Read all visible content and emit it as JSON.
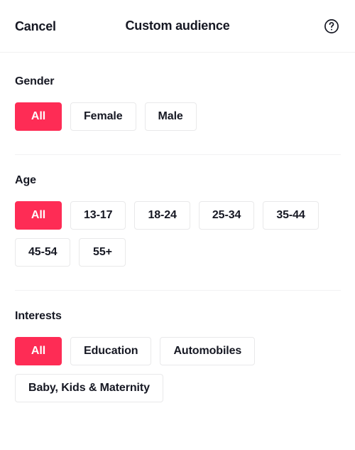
{
  "header": {
    "cancel_label": "Cancel",
    "title": "Custom audience",
    "help_icon": "question-circle-icon"
  },
  "theme": {
    "accent": "#fe2c55",
    "text": "#161823",
    "border": "#e9e9ea",
    "divider": "#f2f2f3",
    "background": "#ffffff"
  },
  "sections": [
    {
      "id": "gender",
      "title": "Gender",
      "options": [
        {
          "label": "All",
          "selected": true
        },
        {
          "label": "Female",
          "selected": false
        },
        {
          "label": "Male",
          "selected": false
        }
      ]
    },
    {
      "id": "age",
      "title": "Age",
      "options": [
        {
          "label": "All",
          "selected": true
        },
        {
          "label": "13-17",
          "selected": false
        },
        {
          "label": "18-24",
          "selected": false
        },
        {
          "label": "25-34",
          "selected": false
        },
        {
          "label": "35-44",
          "selected": false
        },
        {
          "label": "45-54",
          "selected": false
        },
        {
          "label": "55+",
          "selected": false
        }
      ]
    },
    {
      "id": "interests",
      "title": "Interests",
      "options": [
        {
          "label": "All",
          "selected": true
        },
        {
          "label": "Education",
          "selected": false
        },
        {
          "label": "Automobiles",
          "selected": false
        },
        {
          "label": "Baby, Kids & Maternity",
          "selected": false
        }
      ]
    }
  ]
}
